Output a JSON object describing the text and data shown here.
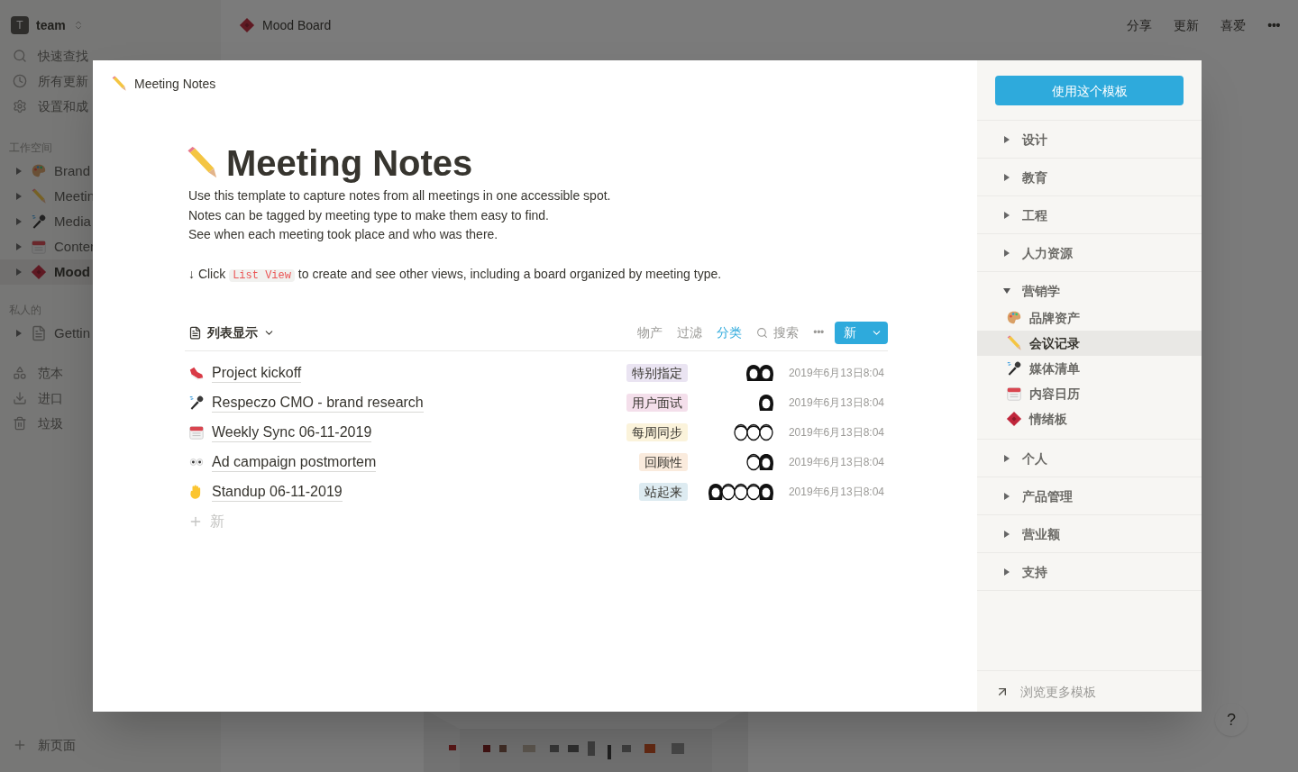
{
  "sidebar": {
    "workspace": {
      "name": "team",
      "initial": "T"
    },
    "quick": [
      {
        "kind": "search",
        "label": "快速查找"
      },
      {
        "kind": "clock",
        "label": "所有更新"
      },
      {
        "kind": "gear",
        "label": "设置和成"
      }
    ],
    "workspace_heading": "工作空间",
    "workspace_pages": [
      {
        "kind": "palette",
        "label": "Brand",
        "selected": false
      },
      {
        "kind": "pencil",
        "label": "Meetin",
        "selected": false
      },
      {
        "kind": "microphone",
        "label": "Media",
        "selected": false
      },
      {
        "kind": "calendar",
        "label": "Conter",
        "selected": false
      },
      {
        "kind": "ticket",
        "label": "Mood",
        "selected": true
      }
    ],
    "private_heading": "私人的",
    "private_pages": [
      {
        "kind": "document",
        "label": "Gettin",
        "selected": false
      }
    ],
    "tools": [
      {
        "kind": "shapes",
        "label": "范本"
      },
      {
        "kind": "download",
        "label": "进口"
      },
      {
        "kind": "trash",
        "label": "垃圾"
      }
    ],
    "new_page": "新页面"
  },
  "topbar": {
    "kind": "ticket",
    "page_title": "Mood Board",
    "actions": [
      "分享",
      "更新",
      "喜爱"
    ],
    "more": "•••"
  },
  "help": "?",
  "modal": {
    "breadcrumb": "Meeting Notes",
    "title": "Meeting Notes",
    "kind": "pencil",
    "description": [
      "Use this template to capture notes from all meetings in one accessible spot.",
      "Notes can be tagged by meeting type to make them easy to find.",
      "See when each meeting took place and who was there."
    ],
    "hint": {
      "before": "↓ Click",
      "code": "List View",
      "after": "to create and see other views, including a board organized by meeting type."
    },
    "view": "列表显示",
    "actions": [
      {
        "label": "物产",
        "selected": false
      },
      {
        "label": "过滤",
        "selected": false
      },
      {
        "label": "分类",
        "selected": true
      }
    ],
    "search": "搜索",
    "more": "•••",
    "new_button": "新",
    "rows": [
      {
        "kind": "shoe",
        "title": "Project kickoff",
        "tag": {
          "label": "特别指定",
          "color": "#eae4f2"
        },
        "attendees": [
          {
            "kind": "dark"
          },
          {
            "kind": "dark"
          }
        ],
        "date": "2019年6月13日8:04"
      },
      {
        "kind": "microphone",
        "title": "Respeczo CMO - brand research",
        "tag": {
          "label": "用户面试",
          "color": "#f4dfeb"
        },
        "attendees": [
          {
            "kind": "dark"
          }
        ],
        "date": "2019年6月13日8:04"
      },
      {
        "kind": "calendar",
        "title": "Weekly Sync 06-11-2019",
        "tag": {
          "label": "每周同步",
          "color": "#fbf3db"
        },
        "attendees": [
          {
            "kind": "line"
          },
          {
            "kind": "line"
          },
          {
            "kind": "line"
          }
        ],
        "date": "2019年6月13日8:04"
      },
      {
        "kind": "eyes",
        "title": "Ad campaign postmortem",
        "tag": {
          "label": "回顾性",
          "color": "#faebdd"
        },
        "attendees": [
          {
            "kind": "line"
          },
          {
            "kind": "dark"
          }
        ],
        "date": "2019年6月13日8:04"
      },
      {
        "kind": "hand",
        "title": "Standup 06-11-2019",
        "tag": {
          "label": "站起来",
          "color": "#ddebf1"
        },
        "attendees": [
          {
            "kind": "dark"
          },
          {
            "kind": "line"
          },
          {
            "kind": "line"
          },
          {
            "kind": "line"
          },
          {
            "kind": "dark"
          }
        ],
        "date": "2019年6月13日8:04"
      }
    ],
    "add_row": "新",
    "panel": {
      "use_button": "使用这个模板",
      "categories": [
        {
          "label": "设计",
          "expanded": false
        },
        {
          "label": "教育",
          "expanded": false
        },
        {
          "label": "工程",
          "expanded": false
        },
        {
          "label": "人力资源",
          "expanded": false
        },
        {
          "label": "营销学",
          "expanded": true,
          "children": [
            {
              "kind": "palette",
              "label": "品牌资产",
              "selected": false
            },
            {
              "kind": "pencil",
              "label": "会议记录",
              "selected": true
            },
            {
              "kind": "microphone",
              "label": "媒体清单",
              "selected": false
            },
            {
              "kind": "calendar",
              "label": "内容日历",
              "selected": false
            },
            {
              "kind": "ticket",
              "label": "情绪板",
              "selected": false
            }
          ]
        },
        {
          "label": "个人",
          "expanded": false
        },
        {
          "label": "产品管理",
          "expanded": false
        },
        {
          "label": "营业额",
          "expanded": false
        },
        {
          "label": "支持",
          "expanded": false
        }
      ],
      "browse": "浏览更多模板"
    }
  }
}
